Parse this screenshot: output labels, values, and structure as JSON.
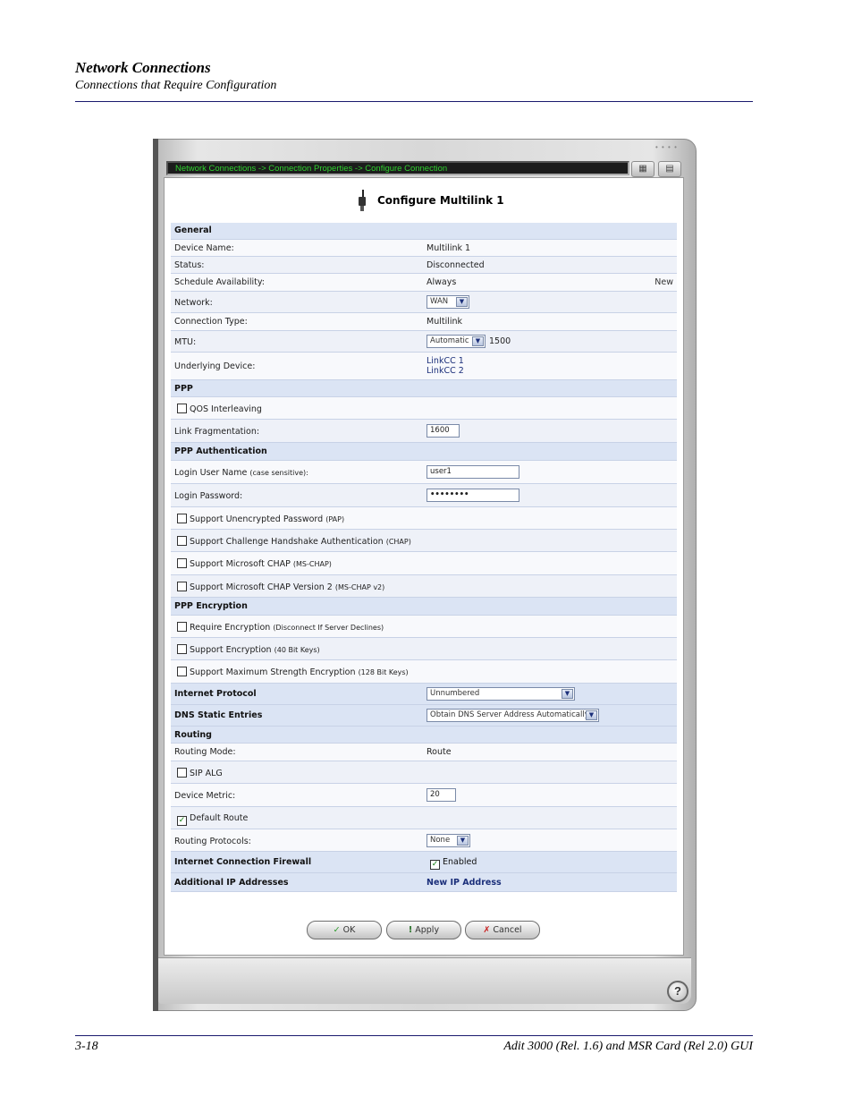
{
  "doc": {
    "header_title": "Network Connections",
    "header_subtitle": "Connections that Require Configuration",
    "footer_left": "3-18",
    "footer_right": "Adit 3000 (Rel. 1.6) and MSR Card (Rel 2.0) GUI"
  },
  "window": {
    "breadcrumb": "Network Connections -> Connection Properties -> Configure Connection",
    "title": "Configure Multilink 1",
    "help_label": "?"
  },
  "form": {
    "general": {
      "section": "General",
      "device_name_label": "Device Name:",
      "device_name": "Multilink 1",
      "status_label": "Status:",
      "status": "Disconnected",
      "schedule_label": "Schedule Availability:",
      "schedule": "Always",
      "schedule_new": "New",
      "network_label": "Network:",
      "network": "WAN",
      "connection_type_label": "Connection Type:",
      "connection_type": "Multilink",
      "mtu_label": "MTU:",
      "mtu_mode": "Automatic",
      "mtu_value": "1500",
      "underlying_label": "Underlying Device:",
      "underlying_1": "LinkCC 1",
      "underlying_2": "LinkCC 2"
    },
    "ppp": {
      "section": "PPP",
      "qos_label": "QOS Interleaving",
      "link_frag_label": "Link Fragmentation:",
      "link_frag": "1600"
    },
    "auth": {
      "section": "PPP Authentication",
      "login_user_label": "Login User Name",
      "login_user_note": "(case sensitive):",
      "login_user": "user1",
      "login_pass_label": "Login Password:",
      "login_pass": "••••••••",
      "pap_label": "Support Unencrypted Password",
      "pap_note": "(PAP)",
      "chap_label": "Support Challenge Handshake Authentication",
      "chap_note": "(CHAP)",
      "mschap_label": "Support Microsoft CHAP",
      "mschap_note": "(MS-CHAP)",
      "mschap2_label": "Support Microsoft CHAP Version 2",
      "mschap2_note": "(MS-CHAP v2)"
    },
    "enc": {
      "section": "PPP Encryption",
      "require_label": "Require Encryption",
      "require_note": "(Disconnect If Server Declines)",
      "support40_label": "Support Encryption",
      "support40_note": "(40 Bit Keys)",
      "support128_label": "Support Maximum Strength Encryption",
      "support128_note": "(128 Bit Keys)"
    },
    "ip": {
      "section": "Internet Protocol",
      "value": "Unnumbered"
    },
    "dns": {
      "section": "DNS Static Entries",
      "value": "Obtain DNS Server Address Automatically"
    },
    "routing": {
      "section": "Routing",
      "mode_label": "Routing Mode:",
      "mode": "Route",
      "sip_label": "SIP ALG",
      "metric_label": "Device Metric:",
      "metric": "20",
      "default_route_label": "Default Route",
      "protocols_label": "Routing Protocols:",
      "protocols": "None"
    },
    "firewall": {
      "section": "Internet Connection Firewall",
      "enabled_label": "Enabled"
    },
    "additional": {
      "section": "Additional IP Addresses",
      "link": "New IP Address"
    }
  },
  "buttons": {
    "ok": "OK",
    "apply": "Apply",
    "cancel": "Cancel"
  },
  "colors": {
    "section_bg": "#dbe4f4",
    "breadcrumb_text": "#2fd22f",
    "link": "#1b2f7a"
  }
}
